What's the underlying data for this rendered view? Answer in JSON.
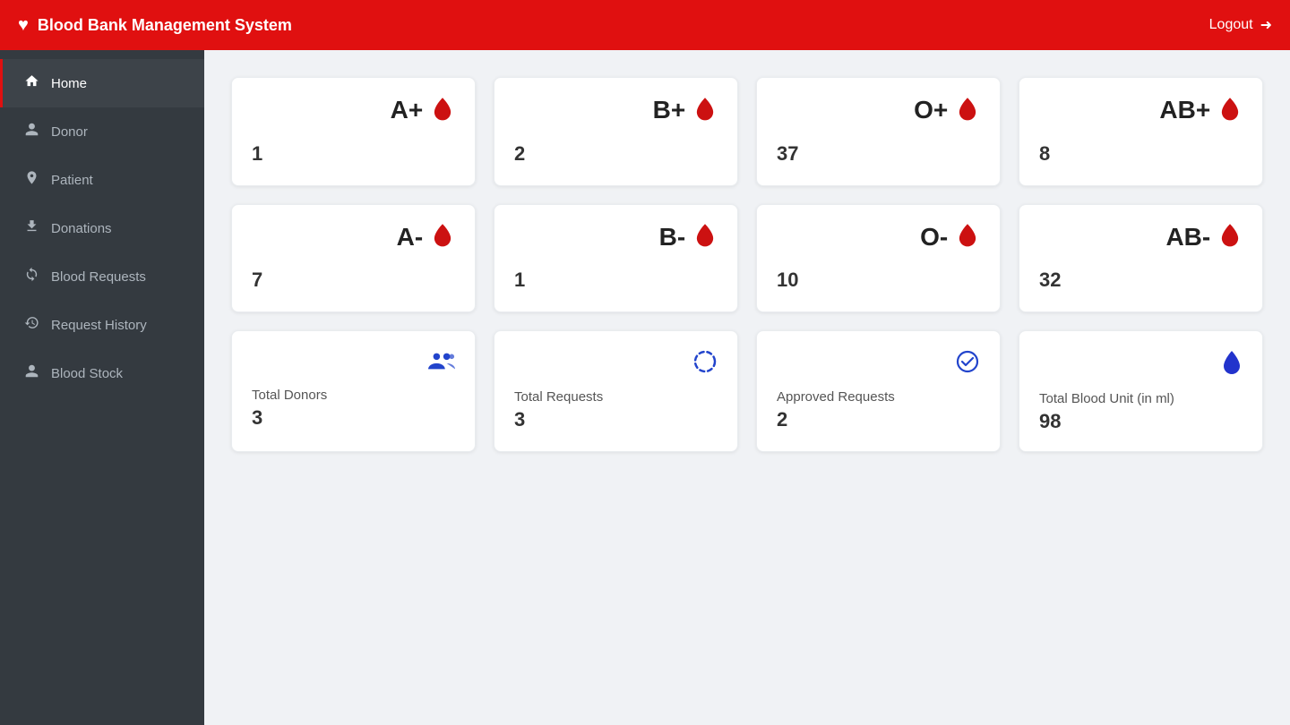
{
  "header": {
    "brand_icon": "♥",
    "brand_name": "Blood Bank Management System",
    "logout_label": "Logout",
    "logout_icon": "→"
  },
  "sidebar": {
    "items": [
      {
        "id": "home",
        "label": "Home",
        "icon": "🏠",
        "active": true
      },
      {
        "id": "donor",
        "label": "Donor",
        "icon": "👤"
      },
      {
        "id": "patient",
        "label": "Patient",
        "icon": "🧑‍⚕️"
      },
      {
        "id": "donations",
        "label": "Donations",
        "icon": "⬇"
      },
      {
        "id": "blood-requests",
        "label": "Blood Requests",
        "icon": "🔄"
      },
      {
        "id": "request-history",
        "label": "Request History",
        "icon": "🕓"
      },
      {
        "id": "blood-stock",
        "label": "Blood Stock",
        "icon": "👤"
      }
    ]
  },
  "blood_type_cards": [
    {
      "type": "A+",
      "value": "1"
    },
    {
      "type": "B+",
      "value": "2"
    },
    {
      "type": "O+",
      "value": "37"
    },
    {
      "type": "AB+",
      "value": "8"
    },
    {
      "type": "A-",
      "value": "7"
    },
    {
      "type": "B-",
      "value": "1"
    },
    {
      "type": "O-",
      "value": "10"
    },
    {
      "type": "AB-",
      "value": "32"
    }
  ],
  "summary_cards": [
    {
      "id": "total-donors",
      "label": "Total Donors",
      "value": "3",
      "icon_type": "users"
    },
    {
      "id": "total-requests",
      "label": "Total Requests",
      "value": "3",
      "icon_type": "spinner"
    },
    {
      "id": "approved-requests",
      "label": "Approved Requests",
      "value": "2",
      "icon_type": "check"
    },
    {
      "id": "total-blood-unit",
      "label": "Total Blood Unit (in ml)",
      "value": "98",
      "icon_type": "drop-blue"
    }
  ]
}
